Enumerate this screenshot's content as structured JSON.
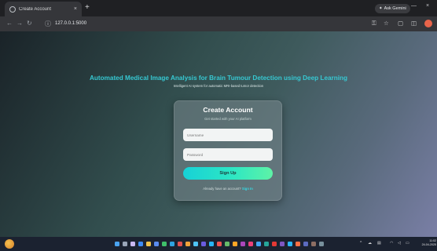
{
  "browser": {
    "tab_title": "Create Account",
    "tab_close": "×",
    "new_tab": "+",
    "gemini_label": "Ask Gemini",
    "url": "127.0.0.1:5000",
    "minimize": "—",
    "close": "×"
  },
  "page": {
    "headline_a": "Automated Medical Image Analysis for Brain Tumour Detection using",
    "headline_b": "Deep Learning",
    "subline": "Intelligent AI system for automatic MRI-based tumor detection",
    "card": {
      "title": "Create Account",
      "subtitle": "Get started with your AI platform",
      "username_placeholder": "Username",
      "password_placeholder": "Password",
      "signup_label": "Sign Up",
      "footer_text": "Already have an account?",
      "signin_link": "Sign In"
    }
  },
  "taskbar": {
    "time": "11:02",
    "date": "24-04-2025"
  },
  "colors": {
    "accent": "#3fd4c6",
    "button_start": "#17d1d6",
    "button_end": "#5ef2a6"
  }
}
